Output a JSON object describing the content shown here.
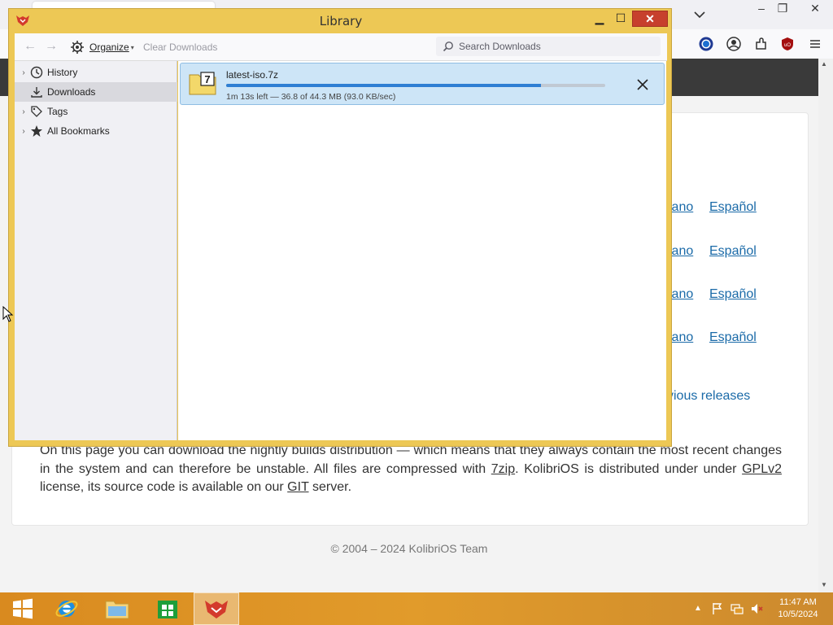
{
  "library": {
    "title": "Library",
    "toolbar": {
      "organize_label": "Organize",
      "clear_downloads_label": "Clear Downloads",
      "search_placeholder": "Search Downloads"
    },
    "sidebar": {
      "items": [
        {
          "label": "History",
          "icon": "clock-icon",
          "expandable": true
        },
        {
          "label": "Downloads",
          "icon": "download-icon",
          "expandable": false,
          "selected": true
        },
        {
          "label": "Tags",
          "icon": "tag-icon",
          "expandable": true
        },
        {
          "label": "All Bookmarks",
          "icon": "star-icon",
          "expandable": true
        }
      ]
    },
    "downloads": [
      {
        "filename": "latest-iso.7z",
        "status": "1m 13s left — 36.8 of 44.3 MB (93.0 KB/sec)",
        "progress_fraction": 0.83
      }
    ]
  },
  "page": {
    "language_links": [
      "iano",
      "Español",
      "iano",
      "Español",
      "iano",
      "Español",
      "iano",
      "Español"
    ],
    "previous_releases": "vious releases",
    "paragraph": {
      "t1": "On this page you can download the nightly builds distribution — which means that they always contain the most recent changes in the system and can therefore be unstable. All files are compressed with ",
      "link1": "7zip",
      "t2": ". KolibriOS is distributed under under ",
      "link2": "GPLv2",
      "t3": " license, its source code is available on our ",
      "link3": "GIT",
      "t4": " server."
    },
    "copyright": "© 2004 – 2024 KolibriOS Team"
  },
  "taskbar": {
    "clock_time": "11:47 AM",
    "clock_date": "10/5/2024"
  },
  "colors": {
    "library_frame": "#edc855",
    "close_button": "#c7402d",
    "progress_fill": "#2f7fd3",
    "download_row_bg": "#cde5f7",
    "taskbar": "#e19b2b"
  }
}
